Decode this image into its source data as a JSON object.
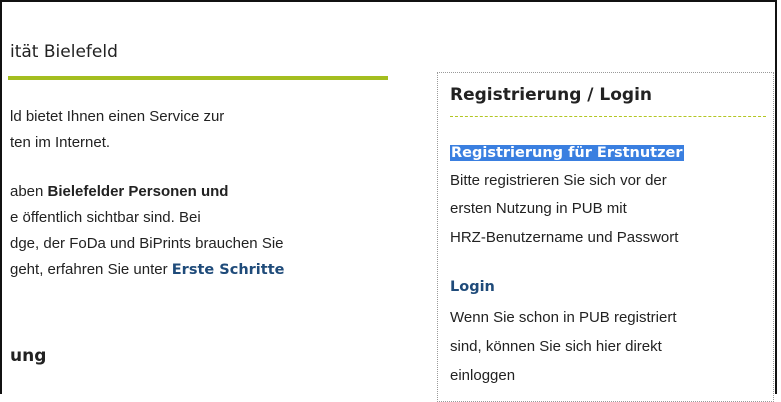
{
  "main": {
    "title": "ität Bielefeld",
    "lines": [
      {
        "before": "ld bietet Ihnen einen Service zur",
        "bold": "",
        "after": "",
        "link": ""
      },
      {
        "before": "ten im Internet.",
        "bold": "",
        "after": "",
        "link": ""
      },
      {
        "before": "aben ",
        "bold": "Bielefelder Personen und",
        "after": "",
        "link": ""
      },
      {
        "before": "e öffentlich sichtbar sind. Bei",
        "bold": "",
        "after": "",
        "link": ""
      },
      {
        "before": "dge, der FoDa und BiPrints brauchen Sie",
        "bold": "",
        "after": "",
        "link": ""
      },
      {
        "before": "geht, erfahren Sie unter ",
        "bold": "",
        "after": "",
        "link": "Erste Schritte"
      }
    ],
    "section_heading": "ung"
  },
  "sidebar": {
    "title": "Registrierung / Login",
    "register": {
      "link": "Registrierung für Erstnutzer",
      "lines": [
        "Bitte registrieren Sie sich vor der",
        "ersten Nutzung in PUB mit",
        "HRZ-Benutzername und Passwort"
      ]
    },
    "login": {
      "link": "Login",
      "lines": [
        "Wenn Sie schon in PUB registriert",
        "sind, können Sie sich hier direkt",
        "einloggen"
      ]
    }
  },
  "colors": {
    "accent_green": "#a4be1f",
    "link_blue": "#1f4b7a",
    "selection": "#3a7fe0"
  }
}
